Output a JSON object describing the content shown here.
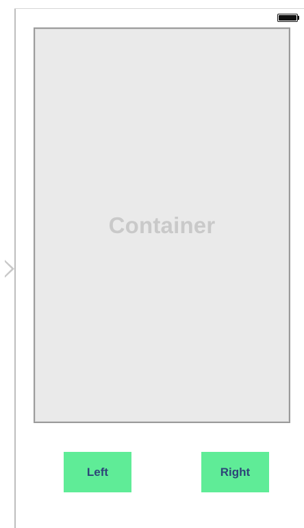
{
  "status_bar": {
    "battery_icon": "battery-full-icon"
  },
  "container": {
    "label": "Container",
    "background_color": "#eaeaea",
    "label_color": "#c9c9c9"
  },
  "buttons": {
    "left_label": "Left",
    "right_label": "Right",
    "background_color": "#5fec97",
    "text_color": "#2d4478"
  },
  "scene": {
    "entry_icon": "entry-point-arrow-icon"
  }
}
